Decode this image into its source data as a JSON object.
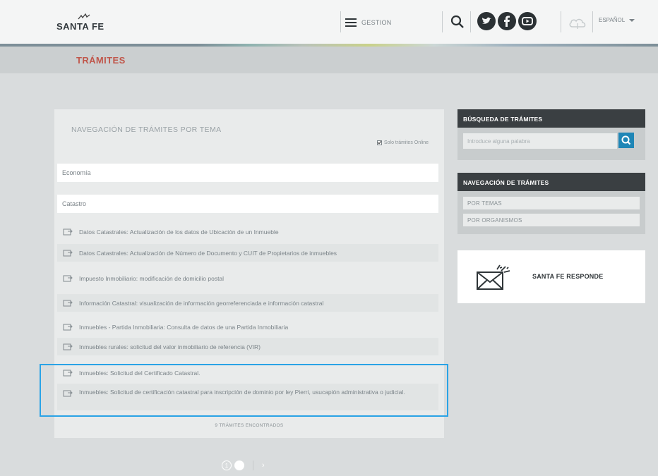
{
  "header": {
    "logo_text": "SANTA FE",
    "menu_label": "GESTION",
    "language": "ESPAÑOL",
    "social_icons": [
      "twitter-icon",
      "facebook-icon",
      "youtube-icon"
    ],
    "colors": {
      "stripe": "#8fb3b0",
      "title_accent": "#c0574b",
      "search_button": "#1f86b6",
      "highlight": "#2aa3e6"
    }
  },
  "page": {
    "title": "TRÁMITES"
  },
  "main": {
    "panel_title": "NAVEGACIÓN DE TRÁMITES POR TEMA",
    "online_only_label": "Solo trámites Online",
    "online_only_checked": true,
    "theme_select": "Economía",
    "subtheme_select": "Catastro",
    "items": [
      "Datos Catastrales: Actualización de los datos de Ubicación de un Inmueble",
      "Datos Catastrales: Actualización de Número de Documento y CUIT de Propietarios de inmuebles",
      "Impuesto Inmobiliario: modificación de domicilio postal",
      "Información Catastral: visualización de información georreferenciada e información catastral",
      "Inmuebles - Partida Inmobiliaria: Consulta de datos de una Partida Inmobiliaria",
      "Inmuebles rurales: solicitud del valor inmobiliario de referencia (VIR)",
      "Inmuebles: Solicitud del Certificado Catastral.",
      "Inmuebles: Solicitud de certificación catastral para inscripción de dominio por ley Pierri, usucapión administrativa o judicial."
    ],
    "found_label": "9 TRÁMITES ENCONTRADOS"
  },
  "pager": {
    "current": "1",
    "next": "›"
  },
  "sidebar": {
    "search_title": "BÚSQUEDA DE TRÁMITES",
    "search_placeholder": "Introduce alguna palabra",
    "nav_title": "NAVEGACIÓN DE TRÁMITES",
    "nav_links": [
      "POR TEMAS",
      "POR ORGANISMOS"
    ],
    "responde_label": "SANTA FE RESPONDE"
  }
}
